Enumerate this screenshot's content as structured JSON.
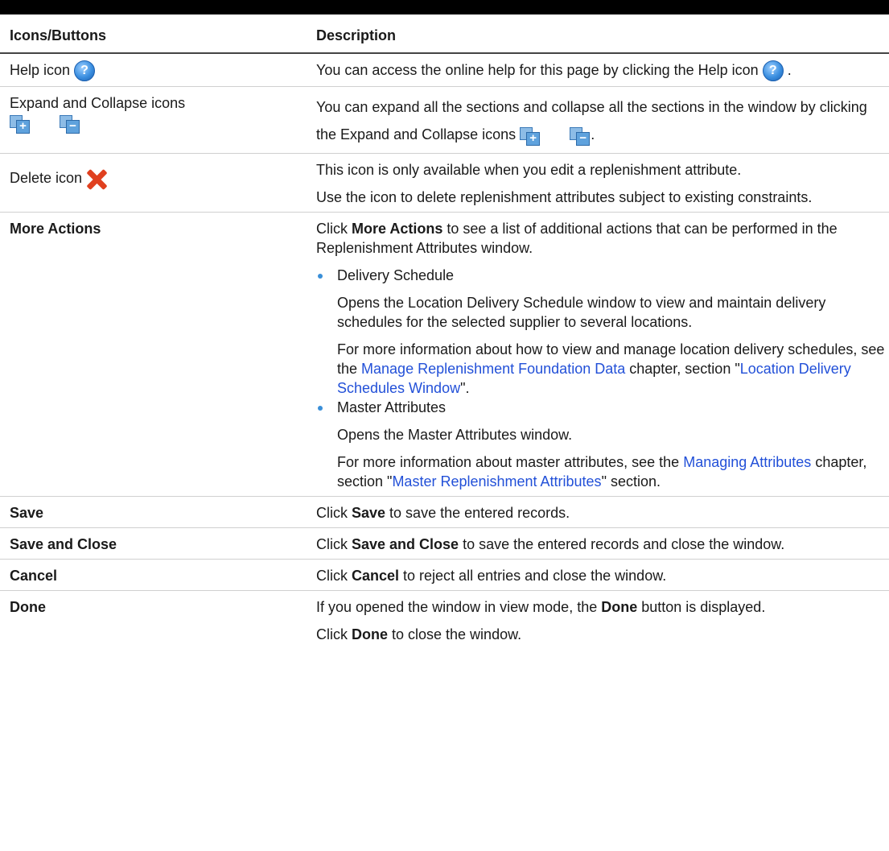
{
  "table": {
    "headers": [
      "Icons/Buttons",
      "Description"
    ],
    "help": {
      "label": "Help icon",
      "desc": "You can access the online help for this page by clicking the Help icon",
      "trail": "."
    },
    "expand": {
      "label": "Expand and Collapse icons",
      "desc": "You can expand all the sections and collapse all the sections in the window by clicking the Expand and Collapse icons",
      "trail": "."
    },
    "delete": {
      "label": "Delete icon",
      "desc1": "This icon is only available when you edit a replenishment attribute.",
      "desc2": "Use the icon to delete replenishment attributes subject to existing constraints."
    },
    "more": {
      "label": "More Actions",
      "intro_pre": "Click ",
      "intro_bold": "More Actions",
      "intro_post": " to see a list of additional actions that can be performed in the Replenishment Attributes window.",
      "items": [
        {
          "title": "Delivery Schedule",
          "desc": "Opens the Location Delivery Schedule window to view and maintain delivery schedules for the selected supplier to several locations.",
          "info_pre": "For more information about how to view and manage location delivery schedules, see the ",
          "info_link1": "Manage Replenishment Foundation Data",
          "info_mid": " chapter, section \"",
          "info_link2": "Location Delivery Schedules Window",
          "info_post": "\"."
        },
        {
          "title": "Master Attributes",
          "desc": "Opens the Master Attributes window.",
          "info_pre": "For more information about master attributes, see the ",
          "info_link1": "Managing Attributes",
          "info_mid": " chapter, section \"",
          "info_link2": "Master Replenishment Attributes",
          "info_post": "\" section."
        }
      ]
    },
    "save": {
      "label": "Save",
      "pre": "Click ",
      "bold": "Save",
      "post": " to save the entered records."
    },
    "save_close": {
      "label": "Save and Close",
      "pre": "Click ",
      "bold": "Save and Close",
      "post": " to save the entered records and close the window."
    },
    "cancel": {
      "label": "Cancel",
      "pre": "Click ",
      "bold": "Cancel",
      "post": " to reject all entries and close the window."
    },
    "done": {
      "label": "Done",
      "p1_pre": "If you opened the window in view mode, the ",
      "p1_bold": "Done",
      "p1_post": " button is displayed.",
      "p2_pre": "Click ",
      "p2_bold": "Done",
      "p2_post": " to close the window."
    }
  },
  "icons": {
    "help": "help-icon",
    "expand": "expand-icon",
    "collapse": "collapse-icon",
    "delete": "delete-icon",
    "help_glyph": "?",
    "expand_glyph": "+",
    "collapse_glyph": "−"
  },
  "colors": {
    "link": "#2250d8",
    "bullet": "#3a8fd8",
    "delete": "#e0401f",
    "help": "#3b8fe0"
  }
}
